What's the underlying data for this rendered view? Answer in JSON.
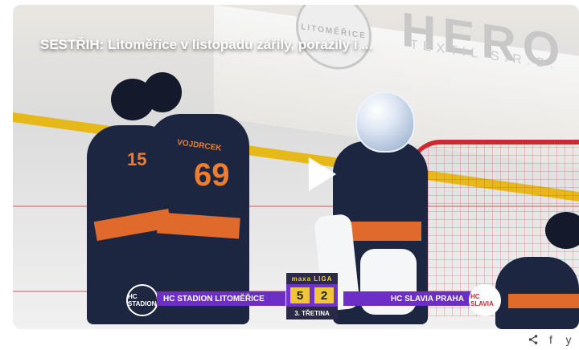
{
  "video": {
    "title": "SESTŘIH: Litoměřice v listopadu zářily, porazily i ...",
    "ad_round_text": "LITOMĚŘICE",
    "ad_brand_text": "HERO",
    "ad_sub_text": "TEXTIL S.R.O."
  },
  "scoreboard": {
    "brand_top": "maxa LIGA",
    "home_team": "HC STADION LITOMĚŘICE",
    "away_team": "HC SLAVIA PRAHA",
    "home_score": "5",
    "away_score": "2",
    "period": "3. TŘETINA",
    "home_logo_text": "HC STADION",
    "away_logo_text": "HC SLAVIA"
  },
  "players": {
    "front_number": "15",
    "back_number": "69",
    "back_name": "VOJDRCEK"
  },
  "share": {
    "share_icon": "share-icon",
    "facebook_label": "f",
    "twitter_label": "y"
  },
  "colors": {
    "accent_purple": "#6d2ec8",
    "score_gold": "#f0c53b",
    "ice_red": "#cf2830"
  }
}
